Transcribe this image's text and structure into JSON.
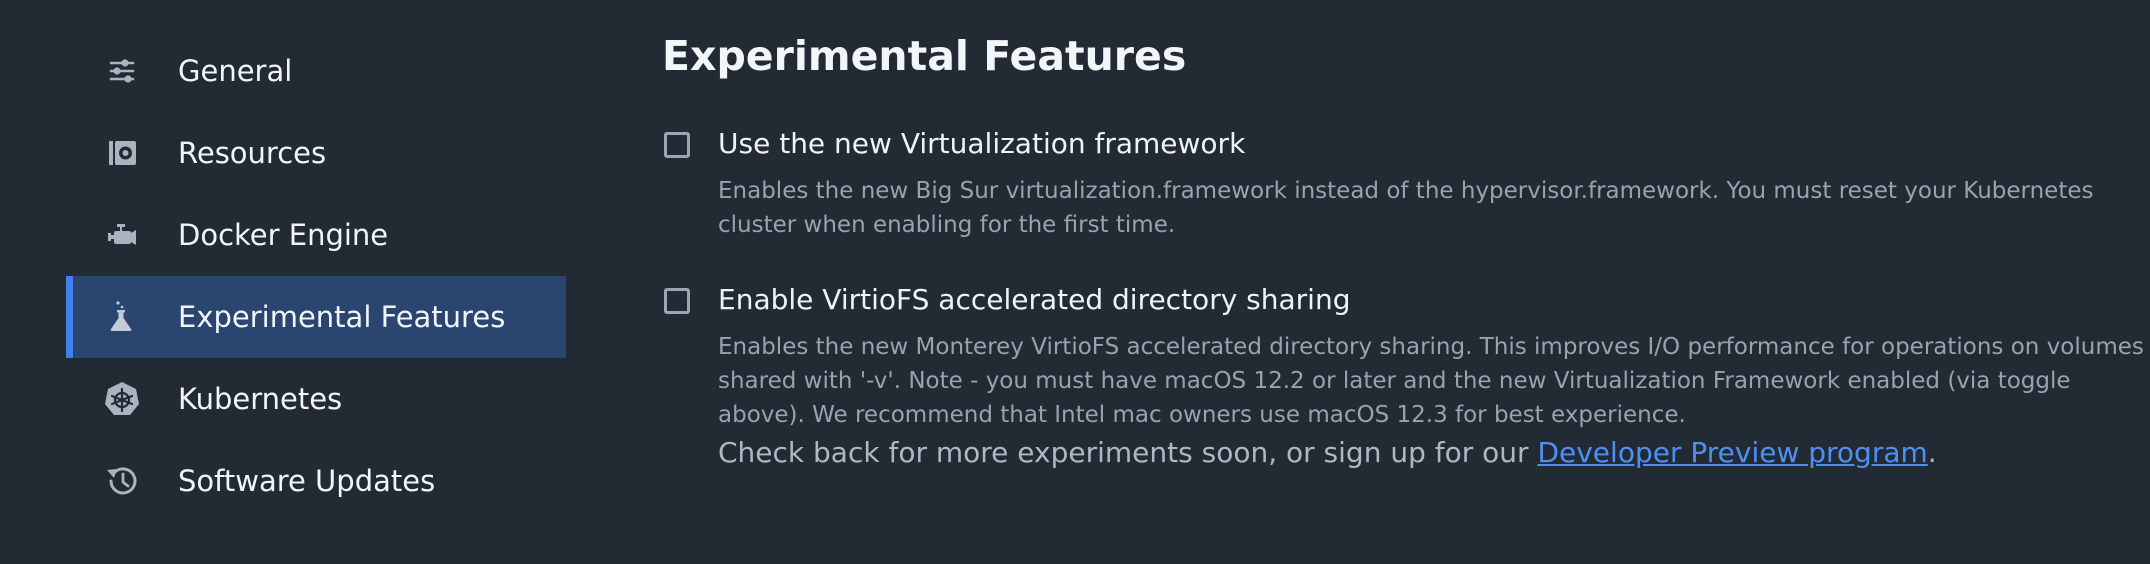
{
  "sidebar": {
    "items": [
      {
        "label": "General",
        "icon": "sliders-icon"
      },
      {
        "label": "Resources",
        "icon": "resources-icon"
      },
      {
        "label": "Docker Engine",
        "icon": "engine-icon"
      },
      {
        "label": "Experimental Features",
        "icon": "flask-icon",
        "active": true
      },
      {
        "label": "Kubernetes",
        "icon": "kubernetes-icon"
      },
      {
        "label": "Software Updates",
        "icon": "history-icon"
      }
    ]
  },
  "main": {
    "title": "Experimental Features",
    "options": [
      {
        "label": "Use the new Virtualization framework",
        "checked": false,
        "description": "Enables the new Big Sur virtualization.framework instead of the hypervisor.framework. You must reset your Kubernetes cluster when enabling for the first time."
      },
      {
        "label": "Enable VirtioFS accelerated directory sharing",
        "checked": false,
        "description": "Enables the new Monterey VirtioFS accelerated directory sharing. This improves I/O performance for operations on volumes shared with '-v'. Note - you must have macOS 12.2 or later and the new Virtualization Framework enabled (via toggle above). We recommend that Intel mac owners use macOS 12.3 for best experience."
      }
    ],
    "footer": {
      "prefix": "Check back for more experiments soon, or sign up for our ",
      "link": "Developer Preview program",
      "suffix": "."
    }
  },
  "colors": {
    "background": "#222a33",
    "active_item": "#2a4670",
    "accent": "#3d82ea",
    "link": "#4f8ff3"
  }
}
